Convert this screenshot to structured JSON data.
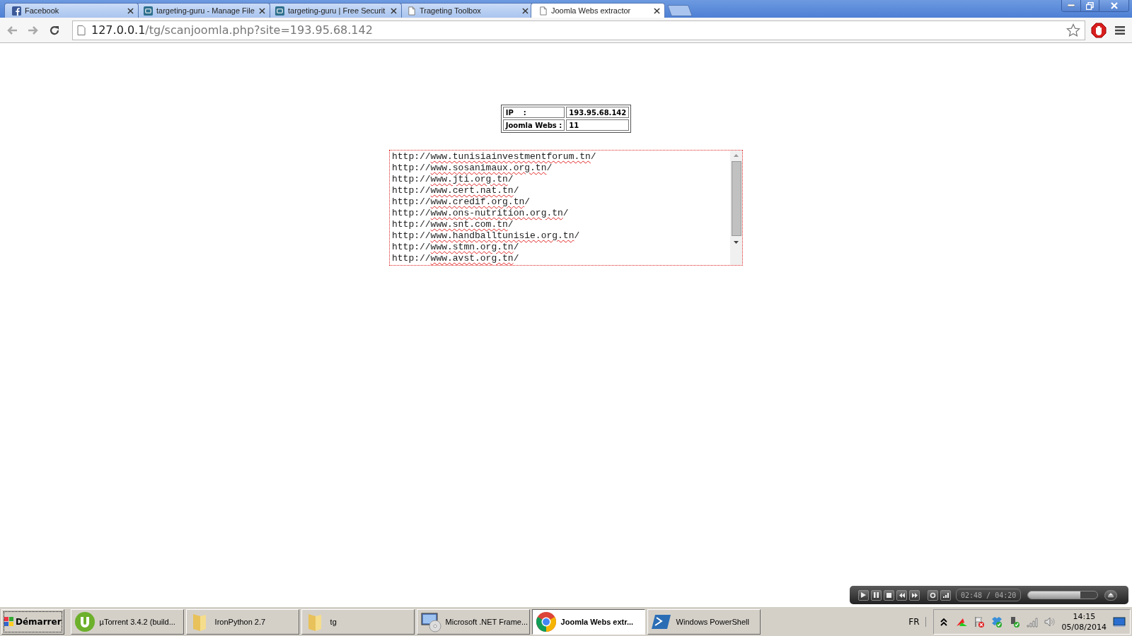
{
  "tabs": [
    {
      "title": "Facebook",
      "selected": false
    },
    {
      "title": "targeting-guru - Manage File",
      "selected": false
    },
    {
      "title": "targeting-guru | Free Securit",
      "selected": false
    },
    {
      "title": "Trageting Toolbox",
      "selected": false
    },
    {
      "title": "Joomla Webs extractor",
      "selected": true
    }
  ],
  "address_bar": {
    "host": "127.0.0.1",
    "path": "/tg/scanjoomla.php?site=193.95.68.142"
  },
  "info_table": [
    {
      "label": "IP    :",
      "value": "193.95.68.142"
    },
    {
      "label": "Joomla Webs :",
      "value": "11"
    }
  ],
  "url_list": [
    "http://www.tunisiainvestmentforum.tn/",
    "http://www.sosanimaux.org.tn/",
    "http://www.jti.org.tn/",
    "http://www.cert.nat.tn/",
    "http://www.credif.org.tn/",
    "http://www.ons-nutrition.org.tn/",
    "http://www.snt.com.tn/",
    "http://www.handballtunisie.org.tn/",
    "http://www.stmn.org.tn/",
    "http://www.avst.org.tn/"
  ],
  "media_player": {
    "time": "02:48 / 04:20",
    "level": 0.75
  },
  "taskbar": {
    "start": "Démarrer",
    "items": [
      {
        "label": "µTorrent 3.4.2  (build...",
        "selected": false
      },
      {
        "label": "IronPython 2.7",
        "selected": false
      },
      {
        "label": "tg",
        "selected": false
      },
      {
        "label": "Microsoft .NET Frame...",
        "selected": false
      },
      {
        "label": "Joomla Webs extr...",
        "selected": true
      },
      {
        "label": "Windows PowerShell",
        "selected": false
      }
    ],
    "language": "FR",
    "time": "14:15",
    "date": "05/08/2014"
  }
}
